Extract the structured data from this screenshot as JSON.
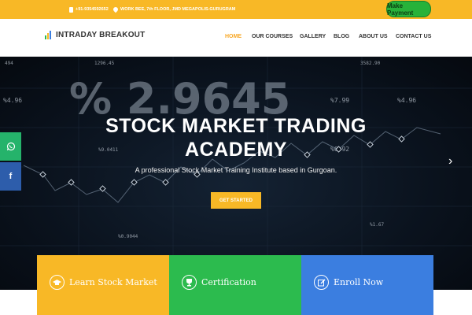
{
  "topbar": {
    "phone": "+91-9354592652",
    "address": "WORK BEE, 7th FLOOR, JMD MEGAPOLIS-GURUGRAM",
    "payment_button": "Make Payment"
  },
  "header": {
    "brand": "INTRADAY BREAKOUT",
    "nav": [
      {
        "label": "HOME",
        "active": true
      },
      {
        "label": "OUR COURSES",
        "active": false
      },
      {
        "label": "GALLERY",
        "active": false
      },
      {
        "label": "BLOG",
        "active": false
      },
      {
        "label": "ABOUT US",
        "active": false
      },
      {
        "label": "CONTACT US",
        "active": false
      }
    ]
  },
  "hero": {
    "title_line1": "STOCK MARKET TRADING",
    "title_line2": "ACADEMY",
    "subtitle": "A professional Stock Market Training Institute based in Gurgoan.",
    "cta": "GET STARTED",
    "bg_big_number": "% 2.9645",
    "bg_labels": [
      "494",
      "1296.45",
      "3582.90",
      "%4.96",
      "%7.99",
      "%4.96",
      "%9.0411",
      "%0.92",
      "%0.9044",
      "%1.67"
    ]
  },
  "social": {
    "whatsapp_icon": "whatsapp-icon",
    "facebook_icon": "facebook-icon"
  },
  "cards": [
    {
      "label": "Learn Stock Market",
      "color": "#f8b826",
      "icon": "graduation-cap-icon"
    },
    {
      "label": "Certification",
      "color": "#2cbb4e",
      "icon": "trophy-icon"
    },
    {
      "label": "Enroll Now",
      "color": "#3b7ee0",
      "icon": "edit-icon"
    }
  ],
  "colors": {
    "accent": "#f8b826",
    "payment": "#27b23a",
    "whatsapp": "#25b36b",
    "facebook": "#2d5dab"
  }
}
